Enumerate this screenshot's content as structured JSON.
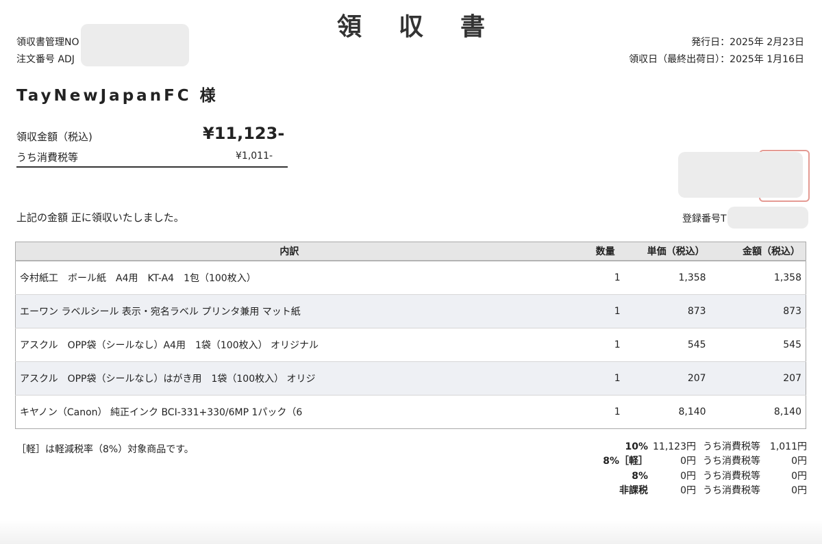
{
  "title": "領収書",
  "header": {
    "receipt_mgmt_label": "領収書管理NO",
    "order_number_label": "注文番号 ADJ",
    "issue_date": "発行日：2025年 2月23日",
    "receipt_date": "領収日（最終出荷日）：2025年 1月16日"
  },
  "customer": "TayNewJapanFC 様",
  "amount": {
    "label": "領収金額（税込)",
    "value": "¥11,123-",
    "tax_label": "うち消費税等",
    "tax_value": "¥1,011-"
  },
  "received_text": "上記の金額 正に領収いたしました。",
  "registration_label": "登録番号T",
  "table": {
    "headers": [
      "内訳",
      "数量",
      "単価（税込）",
      "金額（税込）"
    ],
    "rows": [
      {
        "item": "今村紙工　ボール紙　A4用　KT-A4　1包（100枚入）",
        "qty": "1",
        "unit": "1,358",
        "total": "1,358"
      },
      {
        "item": "エーワン ラベルシール 表示・宛名ラベル プリンタ兼用 マット紙",
        "qty": "1",
        "unit": "873",
        "total": "873"
      },
      {
        "item": "アスクル　OPP袋（シールなし）A4用　1袋（100枚入） オリジナル",
        "qty": "1",
        "unit": "545",
        "total": "545"
      },
      {
        "item": "アスクル　OPP袋（シールなし）はがき用　1袋（100枚入） オリジ",
        "qty": "1",
        "unit": "207",
        "total": "207"
      },
      {
        "item": "キヤノン（Canon） 純正インク BCI-331+330/6MP 1パック（6",
        "qty": "1",
        "unit": "8,140",
        "total": "8,140"
      }
    ]
  },
  "note": "［軽］は軽減税率（8%）対象商品です。",
  "tax_summary": [
    {
      "rate": "10%",
      "amount": "11,123円",
      "label": "うち消費税等",
      "tax": "1,011円"
    },
    {
      "rate": "8%［軽］",
      "amount": "0円",
      "label": "うち消費税等",
      "tax": "0円"
    },
    {
      "rate": "8%",
      "amount": "0円",
      "label": "うち消費税等",
      "tax": "0円"
    },
    {
      "rate": "非課税",
      "amount": "0円",
      "label": "うち消費税等",
      "tax": "0円"
    }
  ]
}
